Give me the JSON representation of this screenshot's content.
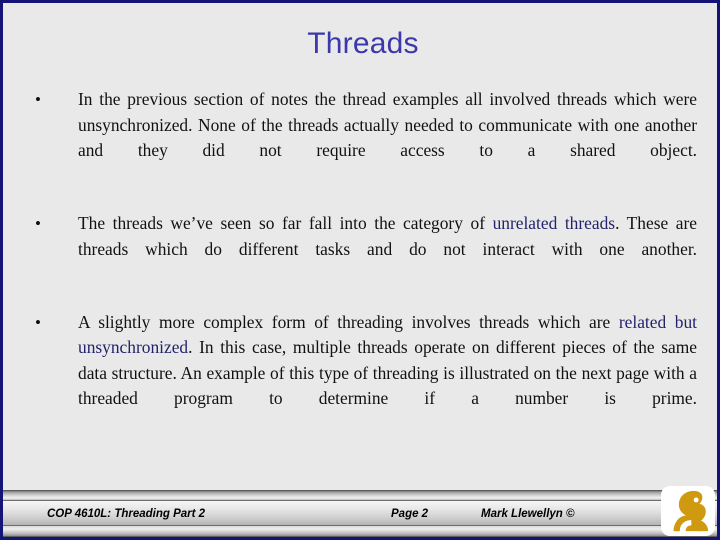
{
  "slide": {
    "title": "Threads",
    "background_color": "#e9e9e9",
    "border_color": "#141478",
    "title_color": "#3b38ab",
    "highlight_color": "#23236b",
    "bullet_marker": "•"
  },
  "bullets": [
    {
      "marker": "•",
      "segments": [
        {
          "text": "In the previous section of notes the thread examples all involved threads which were unsynchronized.  None of the threads actually needed to communicate with one another and they did not require access to a shared object.",
          "style": "normal"
        }
      ]
    },
    {
      "marker": "•",
      "segments": [
        {
          "text": "The threads we’ve seen so far fall into the category of ",
          "style": "normal"
        },
        {
          "text": "unrelated threads",
          "style": "highlight"
        },
        {
          "text": ".  These are threads which do different tasks and do not interact with one another.",
          "style": "normal"
        }
      ]
    },
    {
      "marker": "•",
      "segments": [
        {
          "text": "A  slightly more complex form of threading involves threads which are ",
          "style": "normal"
        },
        {
          "text": "related but unsynchronized",
          "style": "highlight"
        },
        {
          "text": ".  In this case, multiple threads operate on different pieces of the same data structure.  An example of this type of threading is illustrated on the next page with a threaded program to determine if a number is prime.",
          "style": "normal"
        }
      ]
    }
  ],
  "footer": {
    "course": "COP 4610L:  Threading Part 2",
    "page": "Page 2",
    "author": "Mark Llewellyn ©",
    "logo": "ucf-pegasus-logo",
    "logo_color": "#cf9a10"
  }
}
